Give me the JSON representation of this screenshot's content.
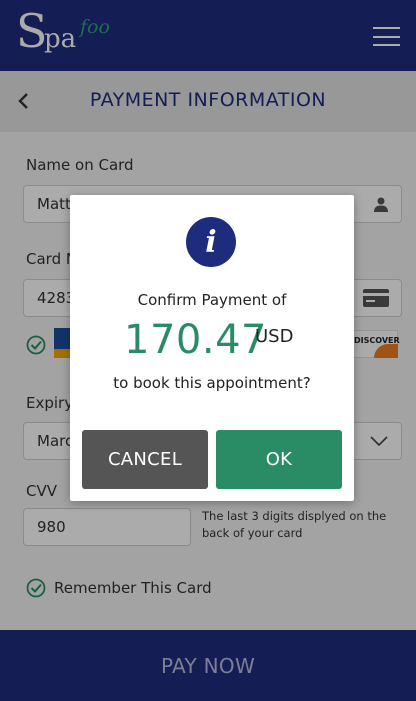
{
  "app": {
    "logo_main": "Spa",
    "logo_accent": "foo",
    "colors": {
      "brand": "#1e2c7e",
      "accent": "#2a8c64",
      "pay_text": "#b9bedd"
    }
  },
  "header": {
    "title": "PAYMENT INFORMATION"
  },
  "form": {
    "name_label": "Name on Card",
    "name_value": "Matt",
    "card_label": "Card N",
    "card_value": "4283",
    "card_brands": [
      "VISA",
      "DISCOVER"
    ],
    "expiry_label": "Expiry",
    "expiry_value": "Marc",
    "cvv_label": "CVV",
    "cvv_value": "980",
    "cvv_hint": "The last 3 digits displyed on the  back of  your card",
    "remember_label": "Remember This Card"
  },
  "dialog": {
    "confirm_text": "Confirm Payment of",
    "amount": "170.47",
    "currency": "USD",
    "book_text": "to book this appointment?",
    "cancel_label": "CANCEL",
    "ok_label": "OK",
    "icon": "info-icon"
  },
  "footer": {
    "pay_label": "PAY NOW"
  }
}
